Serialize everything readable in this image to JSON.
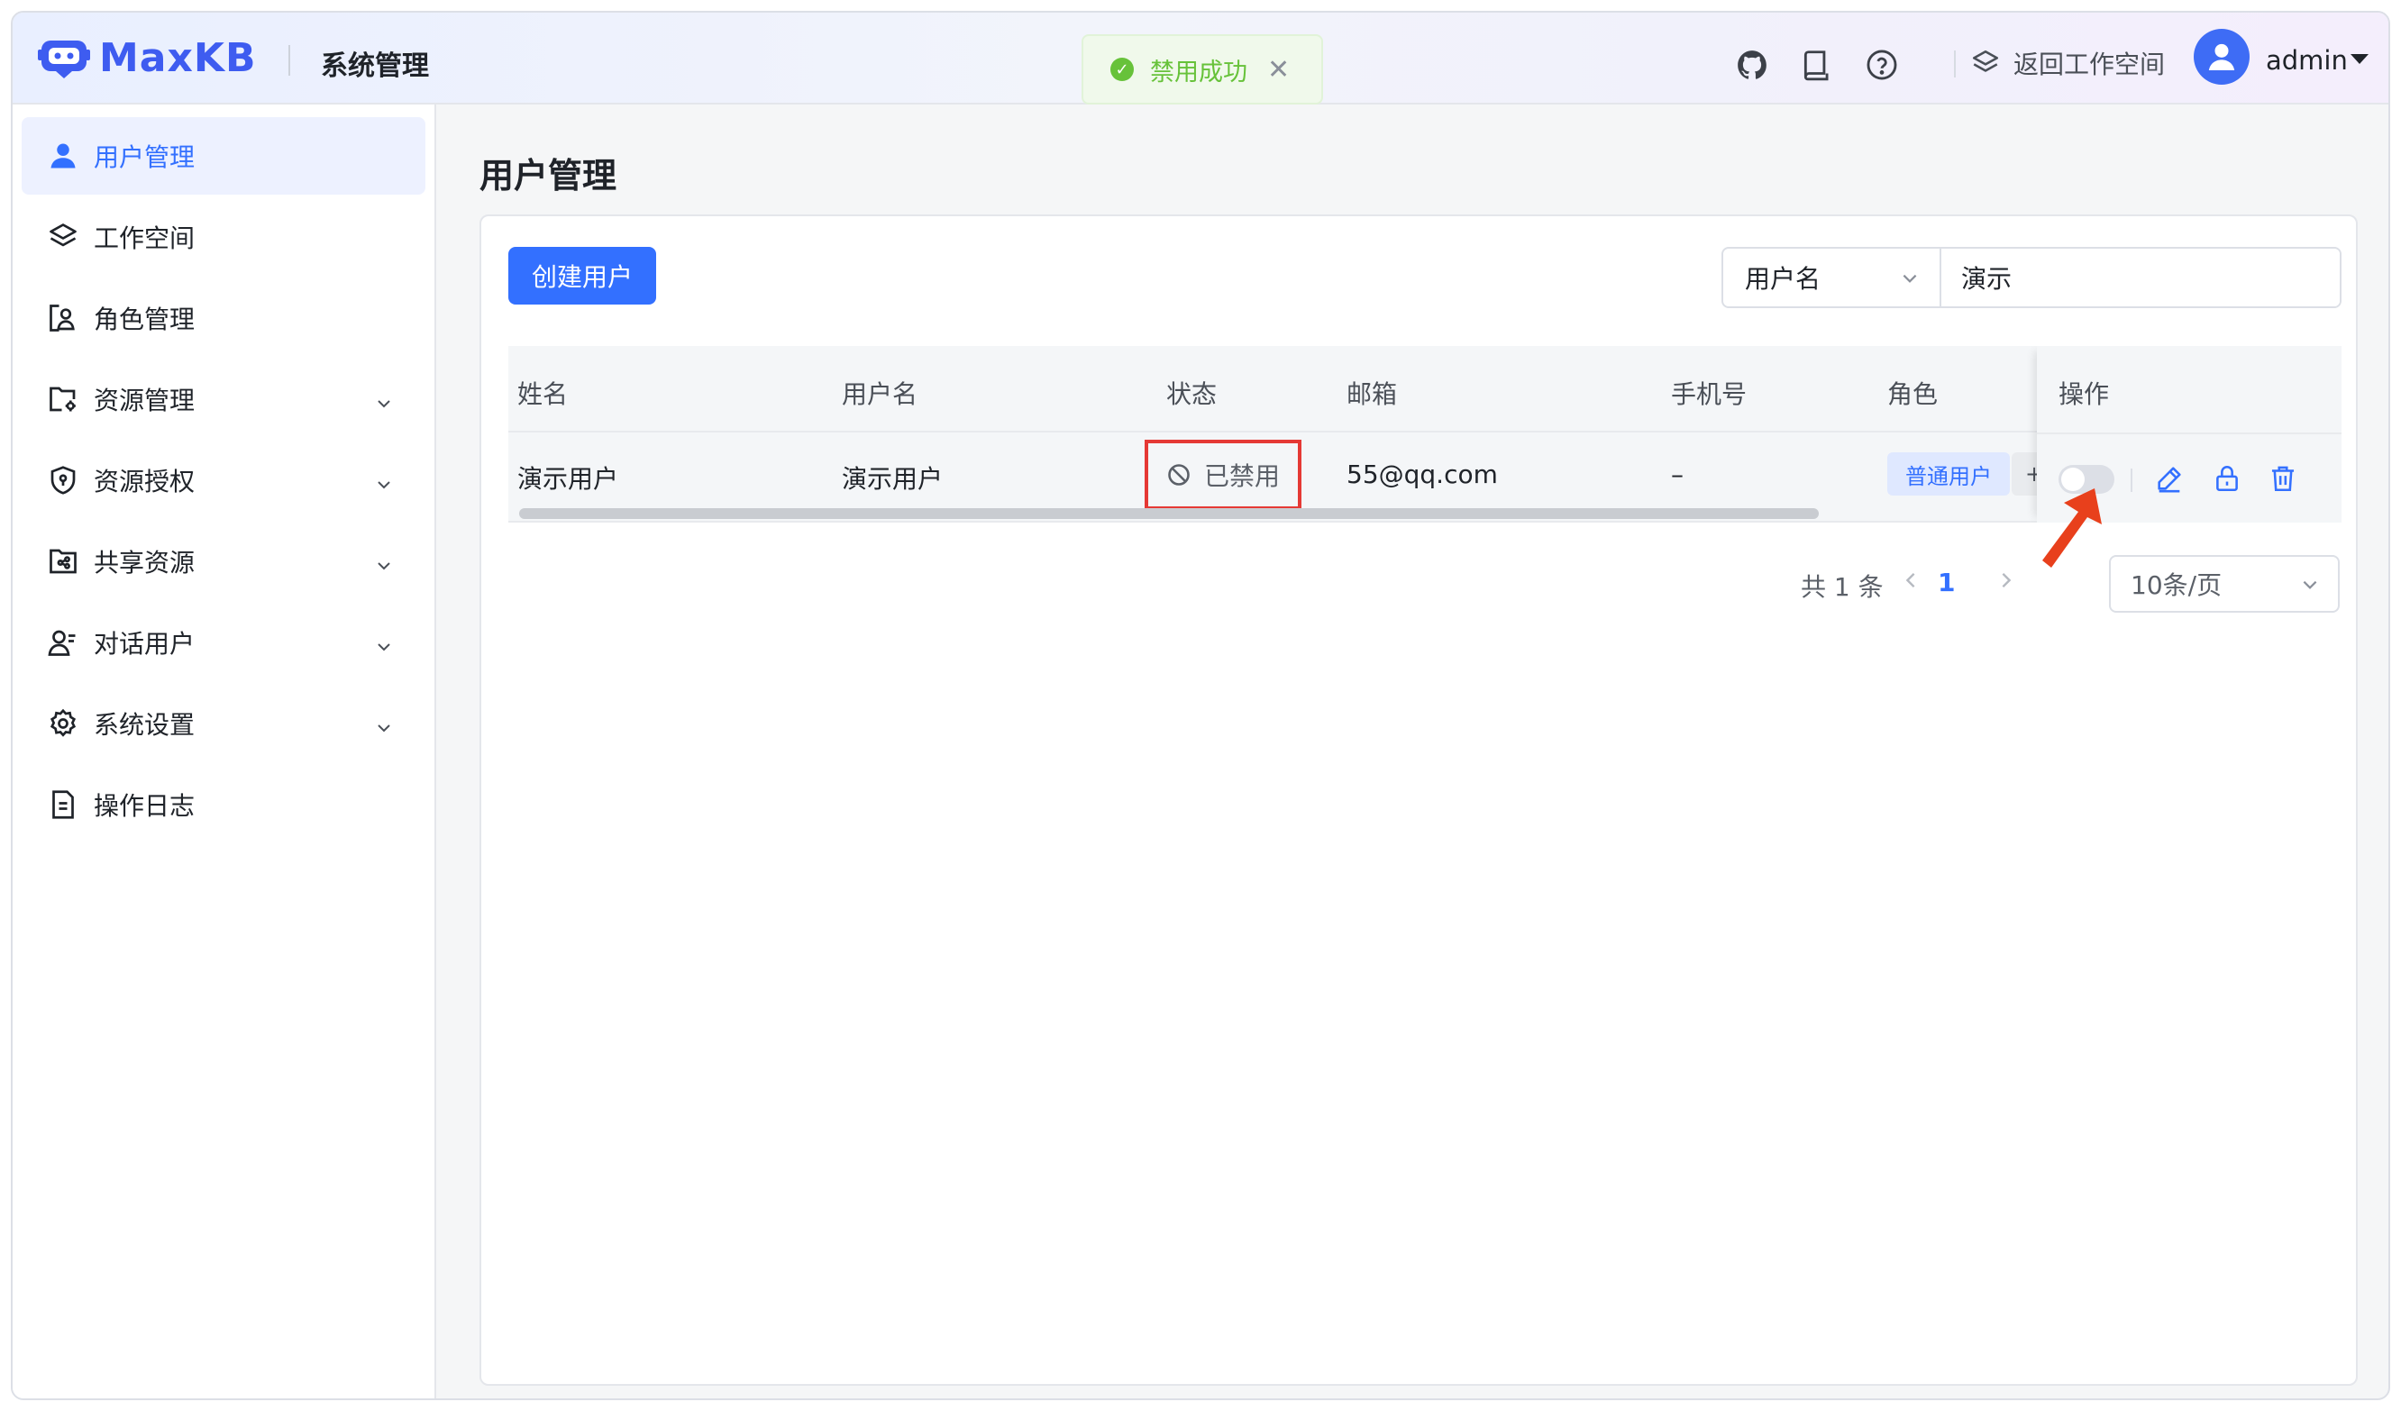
{
  "header": {
    "logo_text": "MaxKB",
    "title": "系统管理",
    "toast": {
      "text": "禁用成功",
      "type": "success"
    },
    "icons": [
      "github-icon",
      "book-icon",
      "help-icon"
    ],
    "back_workspace": "返回工作空间",
    "username": "admin"
  },
  "sidebar": {
    "items": [
      {
        "label": "用户管理",
        "icon": "user-icon",
        "active": true,
        "expandable": false
      },
      {
        "label": "工作空间",
        "icon": "layers-icon",
        "active": false,
        "expandable": false
      },
      {
        "label": "角色管理",
        "icon": "role-icon",
        "active": false,
        "expandable": false
      },
      {
        "label": "资源管理",
        "icon": "folder-gear-icon",
        "active": false,
        "expandable": true
      },
      {
        "label": "资源授权",
        "icon": "shield-icon",
        "active": false,
        "expandable": true
      },
      {
        "label": "共享资源",
        "icon": "share-folder-icon",
        "active": false,
        "expandable": true
      },
      {
        "label": "对话用户",
        "icon": "chat-user-icon",
        "active": false,
        "expandable": true
      },
      {
        "label": "系统设置",
        "icon": "gear-icon",
        "active": false,
        "expandable": true
      },
      {
        "label": "操作日志",
        "icon": "log-icon",
        "active": false,
        "expandable": false
      }
    ]
  },
  "main": {
    "page_title": "用户管理",
    "create_button": "创建用户",
    "search": {
      "field": "用户名",
      "value": "演示"
    },
    "table": {
      "columns": [
        "姓名",
        "用户名",
        "状态",
        "邮箱",
        "手机号",
        "角色",
        "操作"
      ],
      "rows": [
        {
          "name": "演示用户",
          "username": "演示用户",
          "status": "已禁用",
          "email": "55@qq.com",
          "phone": "–",
          "role": "普通用户",
          "role_more": "+",
          "enabled": false
        }
      ]
    },
    "pagination": {
      "total_text": "共 1 条",
      "current_page": "1",
      "page_size": "10条/页"
    }
  },
  "colors": {
    "accent": "#3370ff",
    "success": "#67c23a",
    "highlight_border": "#e53935",
    "annotation_arrow": "#e8401c"
  }
}
